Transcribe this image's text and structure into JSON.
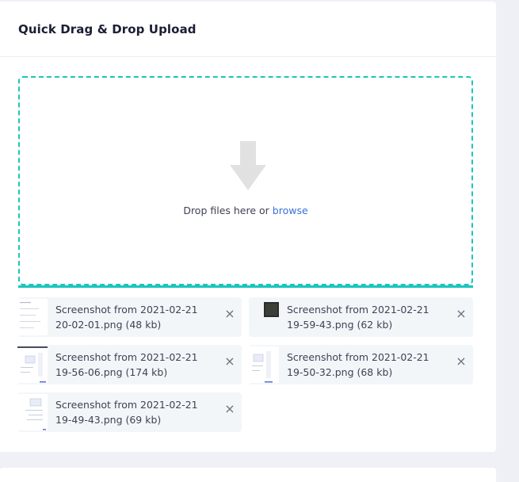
{
  "card": {
    "title": "Quick Drag & Drop Upload"
  },
  "dropzone": {
    "text": "Drop files here or ",
    "browse_label": "browse",
    "border_color": "#1bc5bd",
    "icon": "arrow-down-icon"
  },
  "files": [
    {
      "name": "Screenshot from 2021-02-21 20-02-01.png (48 kb)",
      "thumb": "document-light"
    },
    {
      "name": "Screenshot from 2021-02-21 19-59-43.png (62 kb)",
      "thumb": "dark-image"
    },
    {
      "name": "Screenshot from 2021-02-21 19-56-06.png (174 kb)",
      "thumb": "ui-light"
    },
    {
      "name": "Screenshot from 2021-02-21 19-50-32.png (68 kb)",
      "thumb": "ui-light"
    },
    {
      "name": "Screenshot from 2021-02-21 19-49-43.png (69 kb)",
      "thumb": "ui-light"
    }
  ],
  "remove_symbol": "×"
}
